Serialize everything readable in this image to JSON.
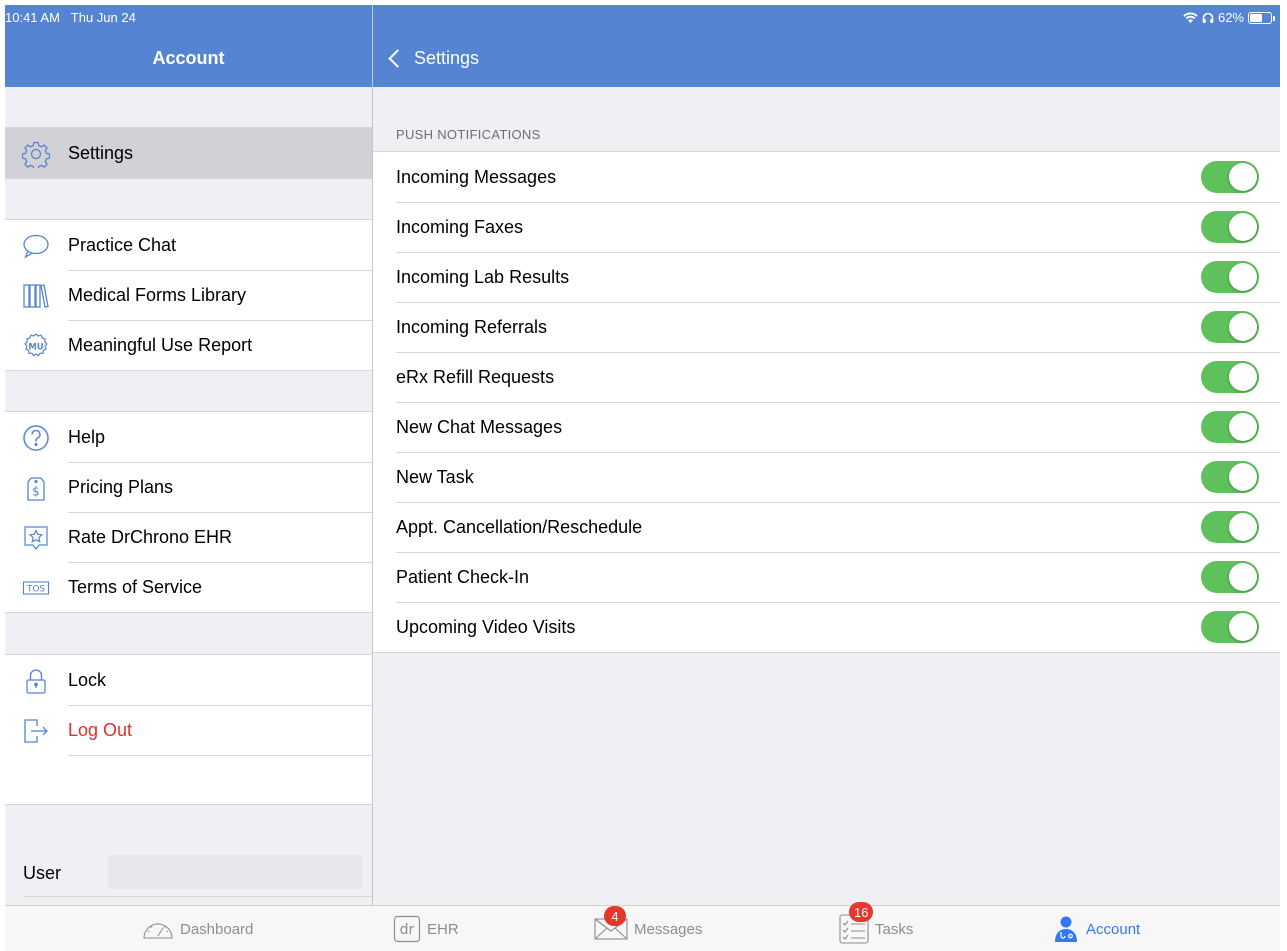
{
  "status_bar": {
    "time": "10:41 AM",
    "date": "Thu Jun 24",
    "battery": "62%",
    "battery_level": 0.62
  },
  "left_header": {
    "title": "Account"
  },
  "right_header": {
    "back_label": "Settings"
  },
  "sidebar": {
    "groups": [
      [
        {
          "label": "Settings",
          "icon": "gear-icon",
          "selected": true
        }
      ],
      [
        {
          "label": "Practice Chat",
          "icon": "chat-bubble-icon"
        },
        {
          "label": "Medical Forms Library",
          "icon": "library-icon"
        },
        {
          "label": "Meaningful Use Report",
          "icon": "mu-badge-icon"
        }
      ],
      [
        {
          "label": "Help",
          "icon": "question-icon"
        },
        {
          "label": "Pricing Plans",
          "icon": "price-tag-icon"
        },
        {
          "label": "Rate DrChrono EHR",
          "icon": "star-icon"
        },
        {
          "label": "Terms of Service",
          "icon": "tos-icon"
        }
      ],
      [
        {
          "label": "Lock",
          "icon": "lock-icon"
        },
        {
          "label": "Log Out",
          "icon": "logout-icon",
          "destructive": true
        }
      ]
    ],
    "user_label": "User"
  },
  "settings": {
    "section_title": "PUSH NOTIFICATIONS",
    "items": [
      {
        "label": "Incoming Messages",
        "on": true
      },
      {
        "label": "Incoming Faxes",
        "on": true
      },
      {
        "label": "Incoming Lab Results",
        "on": true
      },
      {
        "label": "Incoming Referrals",
        "on": true
      },
      {
        "label": "eRx Refill Requests",
        "on": true
      },
      {
        "label": "New Chat Messages",
        "on": true
      },
      {
        "label": "New Task",
        "on": true
      },
      {
        "label": "Appt. Cancellation/Reschedule",
        "on": true
      },
      {
        "label": "Patient Check-In",
        "on": true
      },
      {
        "label": "Upcoming Video Visits",
        "on": true
      }
    ]
  },
  "tabbar": {
    "tabs": [
      {
        "label": "Dashboard",
        "icon": "speedometer-icon"
      },
      {
        "label": "EHR",
        "icon": "dr-logo-icon"
      },
      {
        "label": "Messages",
        "icon": "envelope-icon",
        "badge": "4"
      },
      {
        "label": "Tasks",
        "icon": "checklist-icon",
        "badge": "16"
      },
      {
        "label": "Account",
        "icon": "doctor-icon",
        "active": true
      }
    ]
  },
  "colors": {
    "header": "#5584d2",
    "toggle_on": "#5fc15b",
    "destructive": "#e0302a",
    "active_tab": "#3478f6",
    "badge": "#e5372c"
  }
}
